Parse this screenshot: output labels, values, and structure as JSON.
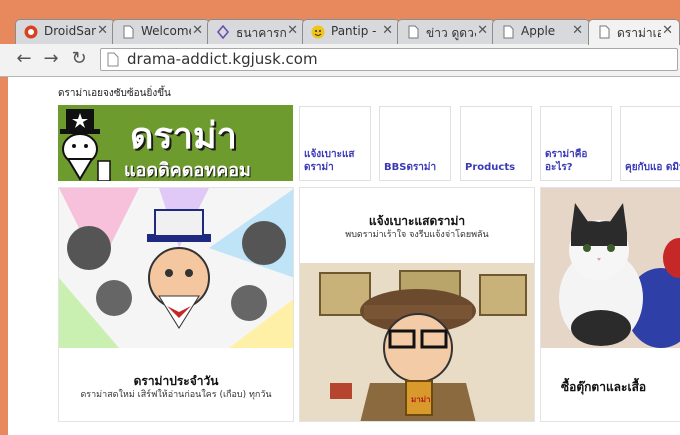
{
  "tabs": [
    {
      "title": "DroidSans",
      "favicon": "droidsans-favicon"
    },
    {
      "title": "Welcome",
      "favicon": "page-icon"
    },
    {
      "title": "ธนาคารก",
      "favicon": "bank-favicon"
    },
    {
      "title": "Pantip -",
      "favicon": "pantip-favicon"
    },
    {
      "title": "ข่าว ดูดวง",
      "favicon": "page-icon"
    },
    {
      "title": "Apple",
      "favicon": "page-icon"
    },
    {
      "title": "ดราม่าเอง",
      "favicon": "page-icon"
    }
  ],
  "close_glyph": "✕",
  "toolbar": {
    "back": "←",
    "forward": "→",
    "reload": "↻"
  },
  "address": {
    "url": "drama-addict.kgjusk.com"
  },
  "page": {
    "tagline": "ดราม่าเอยจงซับซ้อนยิ่งขึ้น",
    "banner": {
      "line1": "ดราม่า",
      "line2": "แอดดิคดอทคอม"
    },
    "nav": [
      {
        "label": "แจ้งเบาะแส ดราม่า"
      },
      {
        "label": "BBSดราม่า"
      },
      {
        "label": "Products"
      },
      {
        "label": "ดราม่าคือ อะไร?"
      },
      {
        "label": "คุยกับแอ ดมิน"
      }
    ],
    "cards": [
      {
        "title": "ดราม่าประจำวัน",
        "subtitle": "ดราม่าสดใหม่ เสิร์ฟให้อ่านก่อนใคร (เกือบ) ทุกวัน"
      },
      {
        "title": "แจ้งเบาะแสดราม่า",
        "subtitle": "พบดราม่าเร้าใจ จงรีบแจ้งจ่าโดยพลัน"
      },
      {
        "title": "ซื้อตุ๊กตาและเสื้อ",
        "subtitle": ""
      }
    ],
    "cup_label": "มาม่า"
  },
  "colors": {
    "frame": "#e8895d",
    "banner": "#6e9b2e",
    "link": "#3a3ab8"
  }
}
